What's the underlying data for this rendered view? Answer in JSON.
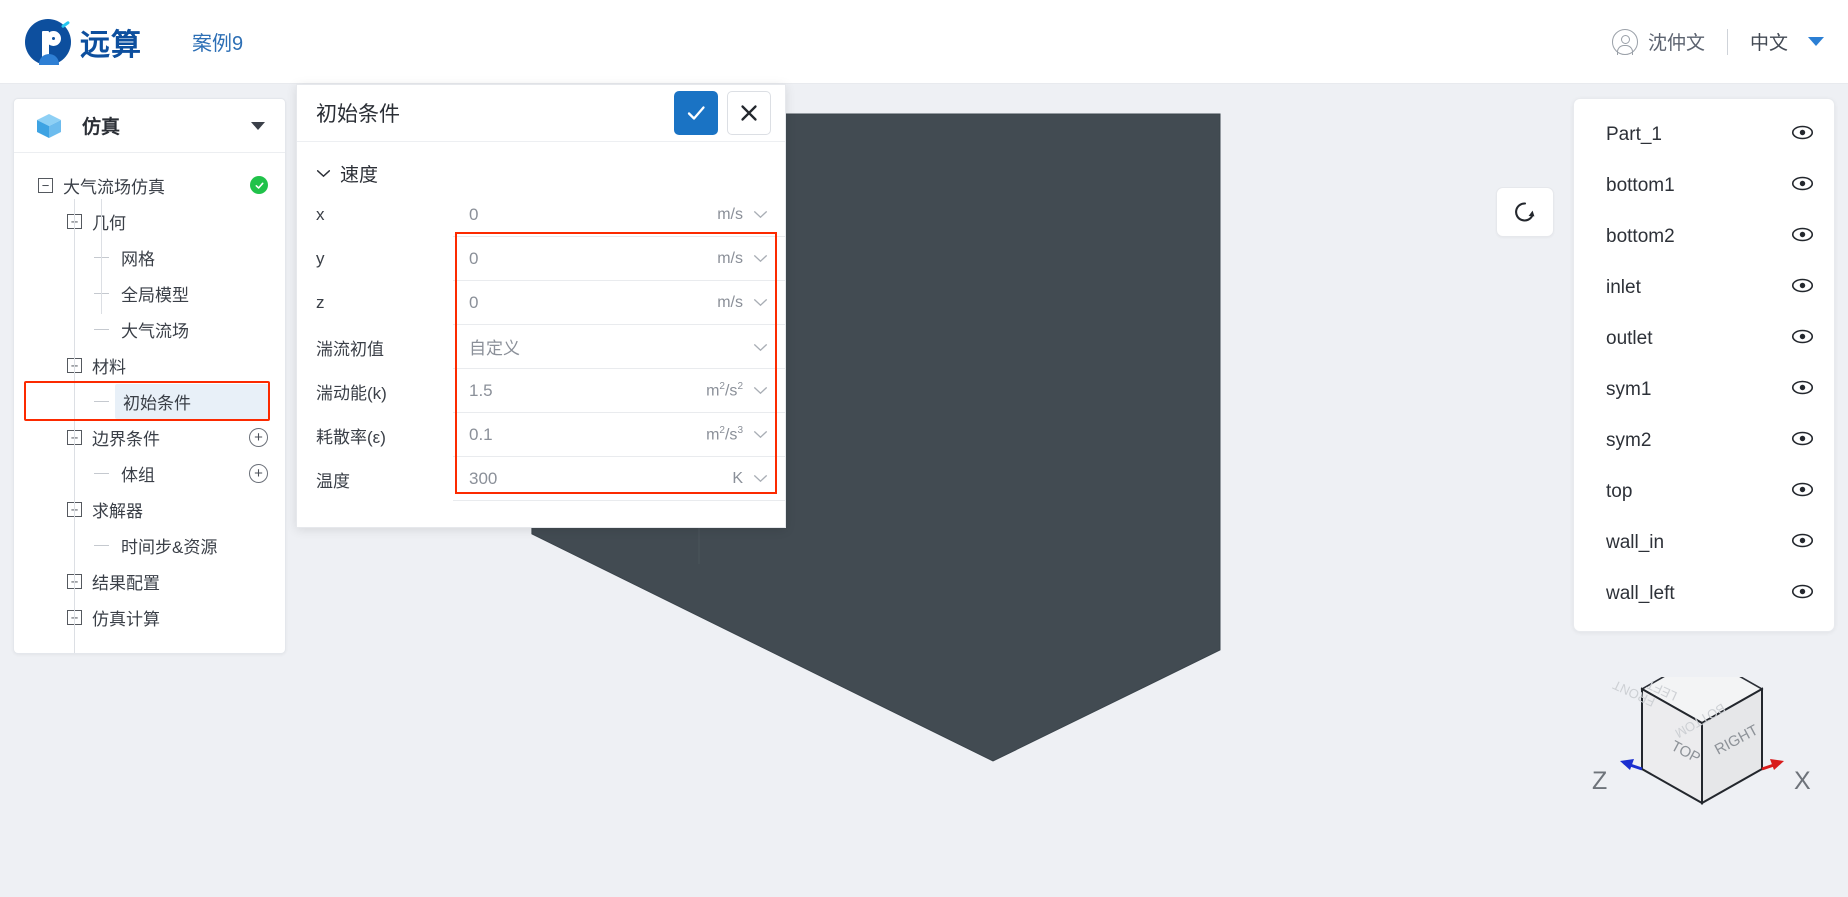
{
  "topbar": {
    "logo_text": "远算",
    "logo_icon": "yuansuan-logo-icon",
    "case_title": "案例9",
    "user_name": "沈仲文",
    "user_icon": "user-circle-icon",
    "language": "中文",
    "caret_icon": "caret-down-icon",
    "accent": "#0d4f9e"
  },
  "sidebar": {
    "header_title": "仿真",
    "header_icon": "cube-icon",
    "collapse_icon": "chevron-down-icon",
    "tree": [
      {
        "label": "大气流场仿真",
        "level": 1,
        "toggle": "minus",
        "status": "check-green"
      },
      {
        "label": "几何",
        "level": 2,
        "toggle": "plus"
      },
      {
        "label": "网格",
        "level": 3,
        "toggle": "dash"
      },
      {
        "label": "全局模型",
        "level": 3,
        "toggle": "dash"
      },
      {
        "label": "大气流场",
        "level": 3,
        "toggle": "dash"
      },
      {
        "label": "材料",
        "level": 2,
        "toggle": "plus"
      },
      {
        "label": "初始条件",
        "level": 3,
        "toggle": "dash",
        "selected": true
      },
      {
        "label": "边界条件",
        "level": 2,
        "toggle": "plus",
        "action": "plus-circle"
      },
      {
        "label": "体组",
        "level": 3,
        "toggle": "dash",
        "action": "plus-circle"
      },
      {
        "label": "求解器",
        "level": 2,
        "toggle": "plus"
      },
      {
        "label": "时间步&资源",
        "level": 3,
        "toggle": "dash"
      },
      {
        "label": "结果配置",
        "level": 2,
        "toggle": "plus"
      },
      {
        "label": "仿真计算",
        "level": 2,
        "toggle": "plus"
      }
    ],
    "highlight_color": "#fc2a00"
  },
  "dialog": {
    "title": "初始条件",
    "ok_icon": "check-icon",
    "ok_color": "#1a73c4",
    "cancel_icon": "close-icon",
    "section_title": "速度",
    "section_chevron": "chevron-down-icon",
    "highlight_color": "#fc2a00",
    "fields": [
      {
        "label": "x",
        "kind": "number",
        "value": "0",
        "unit": "m/s",
        "unit_chevron": "chevron-down-icon"
      },
      {
        "label": "y",
        "kind": "number",
        "value": "0",
        "unit": "m/s",
        "unit_chevron": "chevron-down-icon"
      },
      {
        "label": "z",
        "kind": "number",
        "value": "0",
        "unit": "m/s",
        "unit_chevron": "chevron-down-icon"
      },
      {
        "label": "湍流初值",
        "kind": "select",
        "value": "自定义",
        "unit": "",
        "unit_chevron": "chevron-down-icon"
      },
      {
        "label": "湍动能(k)",
        "kind": "number",
        "value": "1.5",
        "unit": "m2/s2",
        "unit_chevron": "chevron-down-icon"
      },
      {
        "label": "耗散率(ε)",
        "kind": "number",
        "value": "0.1",
        "unit": "m2/s3",
        "unit_chevron": "chevron-down-icon"
      },
      {
        "label": "温度",
        "kind": "number",
        "value": "300",
        "unit": "K",
        "unit_chevron": "chevron-down-icon"
      }
    ]
  },
  "viewport": {
    "reset_icon": "rotate-reset-icon",
    "model_color": "#424b52",
    "background": "#eef0f4",
    "viewcube": {
      "faces": [
        "TOP",
        "RIGHT",
        "BOTTOM",
        "LEFT",
        "FRONT"
      ],
      "axis_z_label": "Z",
      "axis_x_label": "X",
      "axis_z_color": "#1b2fd0",
      "axis_x_color": "#d81b1b"
    }
  },
  "parts_panel": {
    "eye_icon": "eye-icon",
    "items": [
      {
        "name": "Part_1"
      },
      {
        "name": "bottom1"
      },
      {
        "name": "bottom2"
      },
      {
        "name": "inlet"
      },
      {
        "name": "outlet"
      },
      {
        "name": "sym1"
      },
      {
        "name": "sym2"
      },
      {
        "name": "top"
      },
      {
        "name": "wall_in"
      },
      {
        "name": "wall_left"
      }
    ]
  }
}
